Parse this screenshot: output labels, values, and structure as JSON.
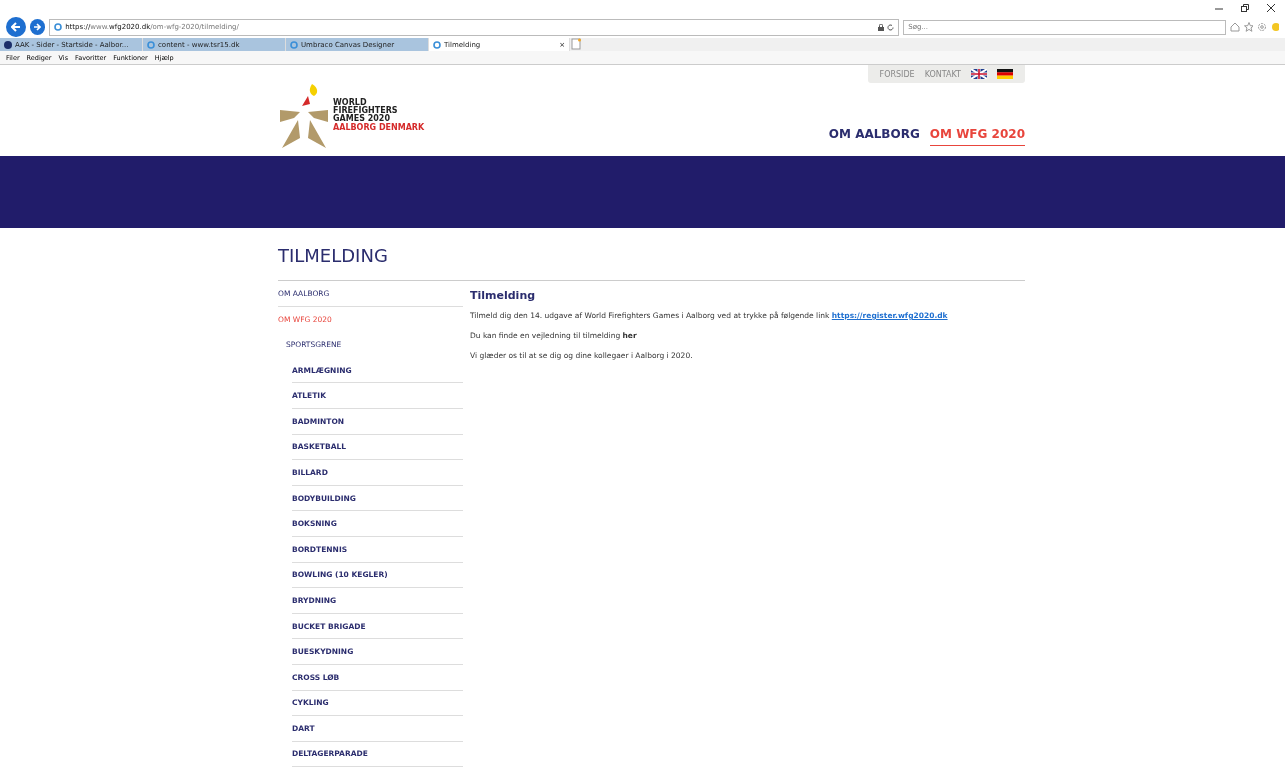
{
  "browser": {
    "address": {
      "scheme": "https://",
      "host": "www.wfg2020.dk",
      "path": "/om-wfg-2020/tilmelding/"
    },
    "search": {
      "placeholder": "Søg..."
    },
    "tabs": [
      {
        "label": "AAK - Sider - Startside - Aalbor...",
        "selected": false
      },
      {
        "label": "content - www.tsr15.dk",
        "selected": false
      },
      {
        "label": "Umbraco Canvas Designer",
        "selected": false
      },
      {
        "label": "Tilmelding",
        "selected": true
      }
    ],
    "close_tab": "×",
    "menu": [
      "Filer",
      "Rediger",
      "Vis",
      "Favoritter",
      "Funktioner",
      "Hjælp"
    ]
  },
  "site": {
    "logo": {
      "lines": [
        "WORLD",
        "FIREFIGHTERS",
        "GAMES 2020"
      ],
      "tagline": "AALBORG DENMARK"
    },
    "top_links": [
      "FORSIDE",
      "KONTAKT"
    ],
    "languages": [
      {
        "kind": "uk"
      },
      {
        "kind": "de"
      }
    ],
    "main_nav": [
      {
        "label": "OM AALBORG",
        "selected": false
      },
      {
        "label": "OM WFG 2020",
        "selected": true
      }
    ],
    "page_title": "TILMELDING",
    "sidebar": [
      {
        "label": "OM AALBORG",
        "selected": false
      },
      {
        "label": "OM WFG 2020",
        "selected": true,
        "children": [
          {
            "label": "SPORTSGRENE",
            "selected": false,
            "children": [
              {
                "label": "ARMLÆGNING",
                "selected": false
              },
              {
                "label": "ATLETIK",
                "selected": false
              },
              {
                "label": "BADMINTON",
                "selected": false
              },
              {
                "label": "BASKETBALL",
                "selected": false
              },
              {
                "label": "BILLARD",
                "selected": false
              },
              {
                "label": "BODYBUILDING",
                "selected": false
              },
              {
                "label": "BOKSNING",
                "selected": false
              },
              {
                "label": "BORDTENNIS",
                "selected": false
              },
              {
                "label": "BOWLING (10 KEGLER)",
                "selected": false
              },
              {
                "label": "BRYDNING",
                "selected": false
              },
              {
                "label": "BUCKET BRIGADE",
                "selected": false
              },
              {
                "label": "BUESKYDNING",
                "selected": false
              },
              {
                "label": "CROSS LØB",
                "selected": false
              },
              {
                "label": "CYKLING",
                "selected": false
              },
              {
                "label": "DART",
                "selected": false
              },
              {
                "label": "DELTAGERPARADE",
                "selected": false
              }
            ]
          }
        ]
      }
    ],
    "article": {
      "heading": "Tilmelding",
      "p1": "Tilmeld dig den 14. udgave af World Firefighters Games i Aalborg ved at trykke på følgende link",
      "p1_link": "https://register.wfg2020.dk",
      "p2": "Du kan finde en vejledning til tilmelding **her**",
      "p3": "Vi glæder os til at se dig og dine kollegaer i Aalborg i 2020."
    }
  }
}
